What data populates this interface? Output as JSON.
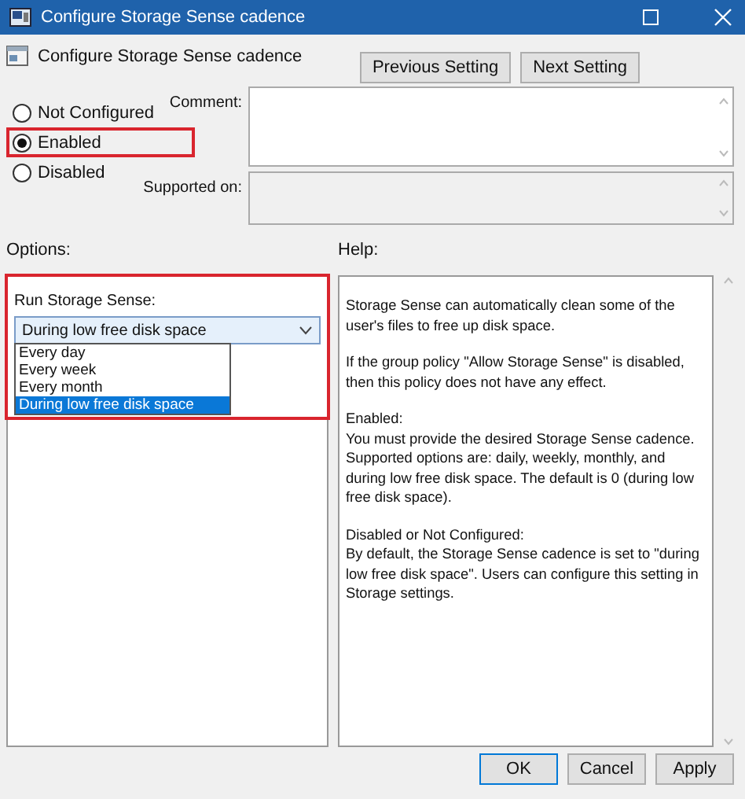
{
  "window": {
    "title": "Configure Storage Sense cadence"
  },
  "header": {
    "title": "Configure Storage Sense cadence",
    "buttons": [
      {
        "label": "Previous Setting"
      },
      {
        "label": "Next Setting"
      }
    ]
  },
  "state_options": [
    {
      "label": "Not Configured",
      "selected": false,
      "highlighted": false
    },
    {
      "label": "Enabled",
      "selected": true,
      "highlighted": true
    },
    {
      "label": "Disabled",
      "selected": false,
      "highlighted": false
    }
  ],
  "comment": {
    "label": "Comment:"
  },
  "supported_on": {
    "label": "Supported on:"
  },
  "options": {
    "heading": "Options:",
    "highlighted": true,
    "setting_label": "Run Storage Sense:",
    "dropdown": {
      "value": "During low free disk space",
      "expanded": true,
      "items": [
        {
          "label": "Every day",
          "selected": false
        },
        {
          "label": "Every week",
          "selected": false
        },
        {
          "label": "Every month",
          "selected": false
        },
        {
          "label": "During low free disk space",
          "selected": true
        }
      ]
    }
  },
  "help": {
    "heading": "Help:",
    "paragraphs": [
      "Storage Sense can automatically clean some of the user's files to free up disk space.",
      "If the group policy \"Allow Storage Sense\" is disabled, then this policy does not have any effect.",
      "Enabled:\nYou must provide the desired Storage Sense cadence. Supported options are: daily, weekly, monthly, and during low free disk space. The default is 0 (during low free disk space).",
      "Disabled or Not Configured:\nBy default, the Storage Sense cadence is set to \"during low free disk space\". Users can configure this setting in Storage settings."
    ]
  },
  "buttons": [
    {
      "label": "OK",
      "default": true
    },
    {
      "label": "Cancel",
      "default": false
    },
    {
      "label": "Apply",
      "default": false
    }
  ]
}
